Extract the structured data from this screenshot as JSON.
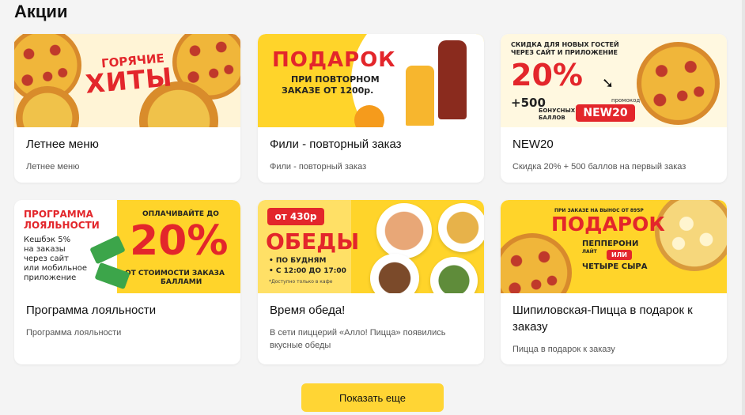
{
  "page": {
    "title": "Акции"
  },
  "promos": [
    {
      "title": "Летнее меню",
      "desc": "Летнее меню",
      "banner": {
        "line1": "ГОРЯЧИЕ",
        "line2": "ХИТЫ"
      }
    },
    {
      "title": "Фили - повторный заказ",
      "desc": "Фили - повторный заказ",
      "banner": {
        "line1": "ПОДАРОК",
        "line2": "ПРИ ПОВТОРНОМ",
        "line3": "ЗАКАЗЕ ОТ 1200р."
      }
    },
    {
      "title": "NEW20",
      "desc": "Скидка 20% + 500 баллов на первый заказ",
      "banner": {
        "line1": "СКИДКА ДЛЯ НОВЫХ ГОСТЕЙ",
        "line2": "ЧЕРЕЗ САЙТ И ПРИЛОЖЕНИЕ",
        "percent": "20%",
        "bonus": "+500",
        "bonus_line1": "БОНУСНЫХ",
        "bonus_line2": "БАЛЛОВ",
        "promo_label": "промокод",
        "code": "NEW20"
      }
    },
    {
      "title": "Программа лояльности",
      "desc": "Программа лояльности",
      "banner": {
        "line1": "ПРОГРАММА",
        "line2": "ЛОЯЛЬНОСТИ",
        "cashback": "Кешбэк 5%",
        "c2": "на заказы",
        "c3": "через сайт",
        "c4": "или мобильное",
        "c5": "приложение",
        "top": "ОПЛАЧИВАЙТЕ ДО",
        "percent": "20%",
        "bottom1": "ОТ СТОИМОСТИ ЗАКАЗА",
        "bottom2": "БАЛЛАМИ"
      }
    },
    {
      "title": "Время обеда!",
      "desc": "В сети пиццерий «Алло! Пицца» появились вкусные обеды",
      "banner": {
        "price": "от 430р",
        "line1": "ОБЕДЫ",
        "l2": "• ПО БУДНЯМ",
        "l3": "• С 12:00 ДО 17:00",
        "note": "*Доступно только в кафе"
      }
    },
    {
      "title": "Шипиловская-Пицца в подарок к заказу",
      "desc": "Пицца в подарок к заказу",
      "banner": {
        "top": "ПРИ ЗАКАЗЕ НА ВЫНОС ОТ 895Р",
        "line1": "ПОДАРОК",
        "p1": "ПЕППЕРОНИ",
        "p1sub": "ЛАЙТ",
        "or": "ИЛИ",
        "p2": "ЧЕТЫРЕ СЫРА"
      }
    }
  ],
  "more_button": {
    "label": "Показать еще"
  },
  "colors": {
    "accent": "#ffd534",
    "red": "#e3262b",
    "banner_yellow": "#ffd42a"
  }
}
